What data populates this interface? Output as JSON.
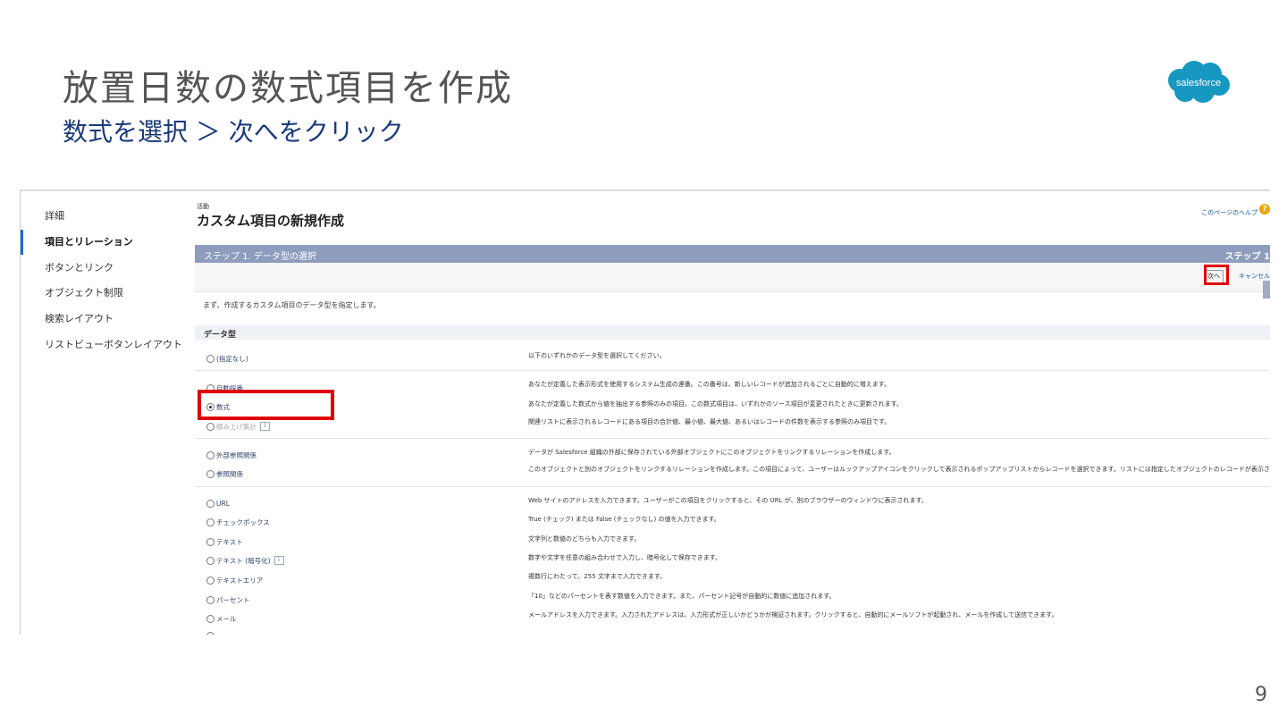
{
  "slide": {
    "title": "放置日数の数式項目を作成",
    "subtitle": "数式を選択 ＞ 次へをクリック",
    "logo_text": "salesforce",
    "page_number": "9",
    "logo_color": "#1798c1",
    "highlight_color": "#e00000"
  },
  "sidebar": {
    "items": [
      {
        "label": "詳細",
        "active": false
      },
      {
        "label": "項目とリレーション",
        "active": true
      },
      {
        "label": "ボタンとリンク",
        "active": false
      },
      {
        "label": "オブジェクト制限",
        "active": false
      },
      {
        "label": "検索レイアウト",
        "active": false
      },
      {
        "label": "リストビューボタンレイアウト",
        "active": false
      }
    ]
  },
  "header": {
    "breadcrumb": "活動",
    "title": "カスタム項目の新規作成",
    "help_link": "このページのヘルプ"
  },
  "step": {
    "title": "ステップ 1. データ型の選択",
    "indicator": "ステップ 1"
  },
  "buttons": {
    "next": "次へ",
    "cancel": "キャンセル"
  },
  "intro": "まず、作成するカスタム項目のデータ型を指定します。",
  "section_label": "データ型",
  "options": [
    {
      "label": "(指定なし)",
      "desc": "以下のいずれかのデータ型を選択してください。",
      "checked": false,
      "disabled": false
    },
    {
      "label": "自動採番",
      "desc": "あなたが定義した表示形式を使用するシステム生成の連番。この番号は、新しいレコードが追加されるごとに自動的に増えます。",
      "checked": false,
      "disabled": false
    },
    {
      "label": "数式",
      "desc": "あなたが定義した数式から値を抽出する参照のみの項目。この数式項目は、いずれかのソース項目が変更されたときに更新されます。",
      "checked": true,
      "disabled": false
    },
    {
      "label": "積み上げ集計",
      "desc": "関連リストに表示されるレコードにある項目の合計値、最小値、最大値、あるいはレコードの件数を表示する参照のみ項目です。",
      "checked": false,
      "disabled": true,
      "info": "i"
    },
    {
      "label": "外部参照関係",
      "desc": "データが Salesforce 組織の外部に保存されている外部オブジェクトにこのオブジェクトをリンクするリレーションを作成します。",
      "checked": false,
      "disabled": false
    },
    {
      "label": "参照関係",
      "desc": "このオブジェクトと別のオブジェクトをリンクするリレーションを作成します。この項目によって、ユーザーはルックアップアイコンをクリックして表示されるポップアップリストからレコードを選択できます。リストには指定したオブジェクトのレコードが表示されます。",
      "checked": false,
      "disabled": false
    },
    {
      "label": "URL",
      "desc": "Web サイトのアドレスを入力できます。ユーザーがこの項目をクリックすると、その URL が、別のブラウザーのウィンドウに表示されます。",
      "checked": false,
      "disabled": false
    },
    {
      "label": "チェックボックス",
      "desc": "True (チェック) または False (チェックなし) の値を入力できます。",
      "checked": false,
      "disabled": false
    },
    {
      "label": "テキスト",
      "desc": "文字列と数値のどちらも入力できます。",
      "checked": false,
      "disabled": false
    },
    {
      "label": "テキスト (暗号化)",
      "desc": "数字や文字を任意の組み合わせで入力し、暗号化して保存できます。",
      "checked": false,
      "disabled": false,
      "info": "i"
    },
    {
      "label": "テキストエリア",
      "desc": "複数行にわたって、255 文字まで入力できます。",
      "checked": false,
      "disabled": false
    },
    {
      "label": "パーセント",
      "desc": "「10」などのパーセントを表す数値を入力できます。また、パーセント記号が自動的に数値に追加されます。",
      "checked": false,
      "disabled": false
    },
    {
      "label": "メール",
      "desc": "メールアドレスを入力できます。入力されたアドレスは、入力形式が正しいかどうかが検証されます。クリックすると、自動的にメールソフトが起動され、メールを作成して送信できます。",
      "checked": false,
      "disabled": false
    }
  ]
}
